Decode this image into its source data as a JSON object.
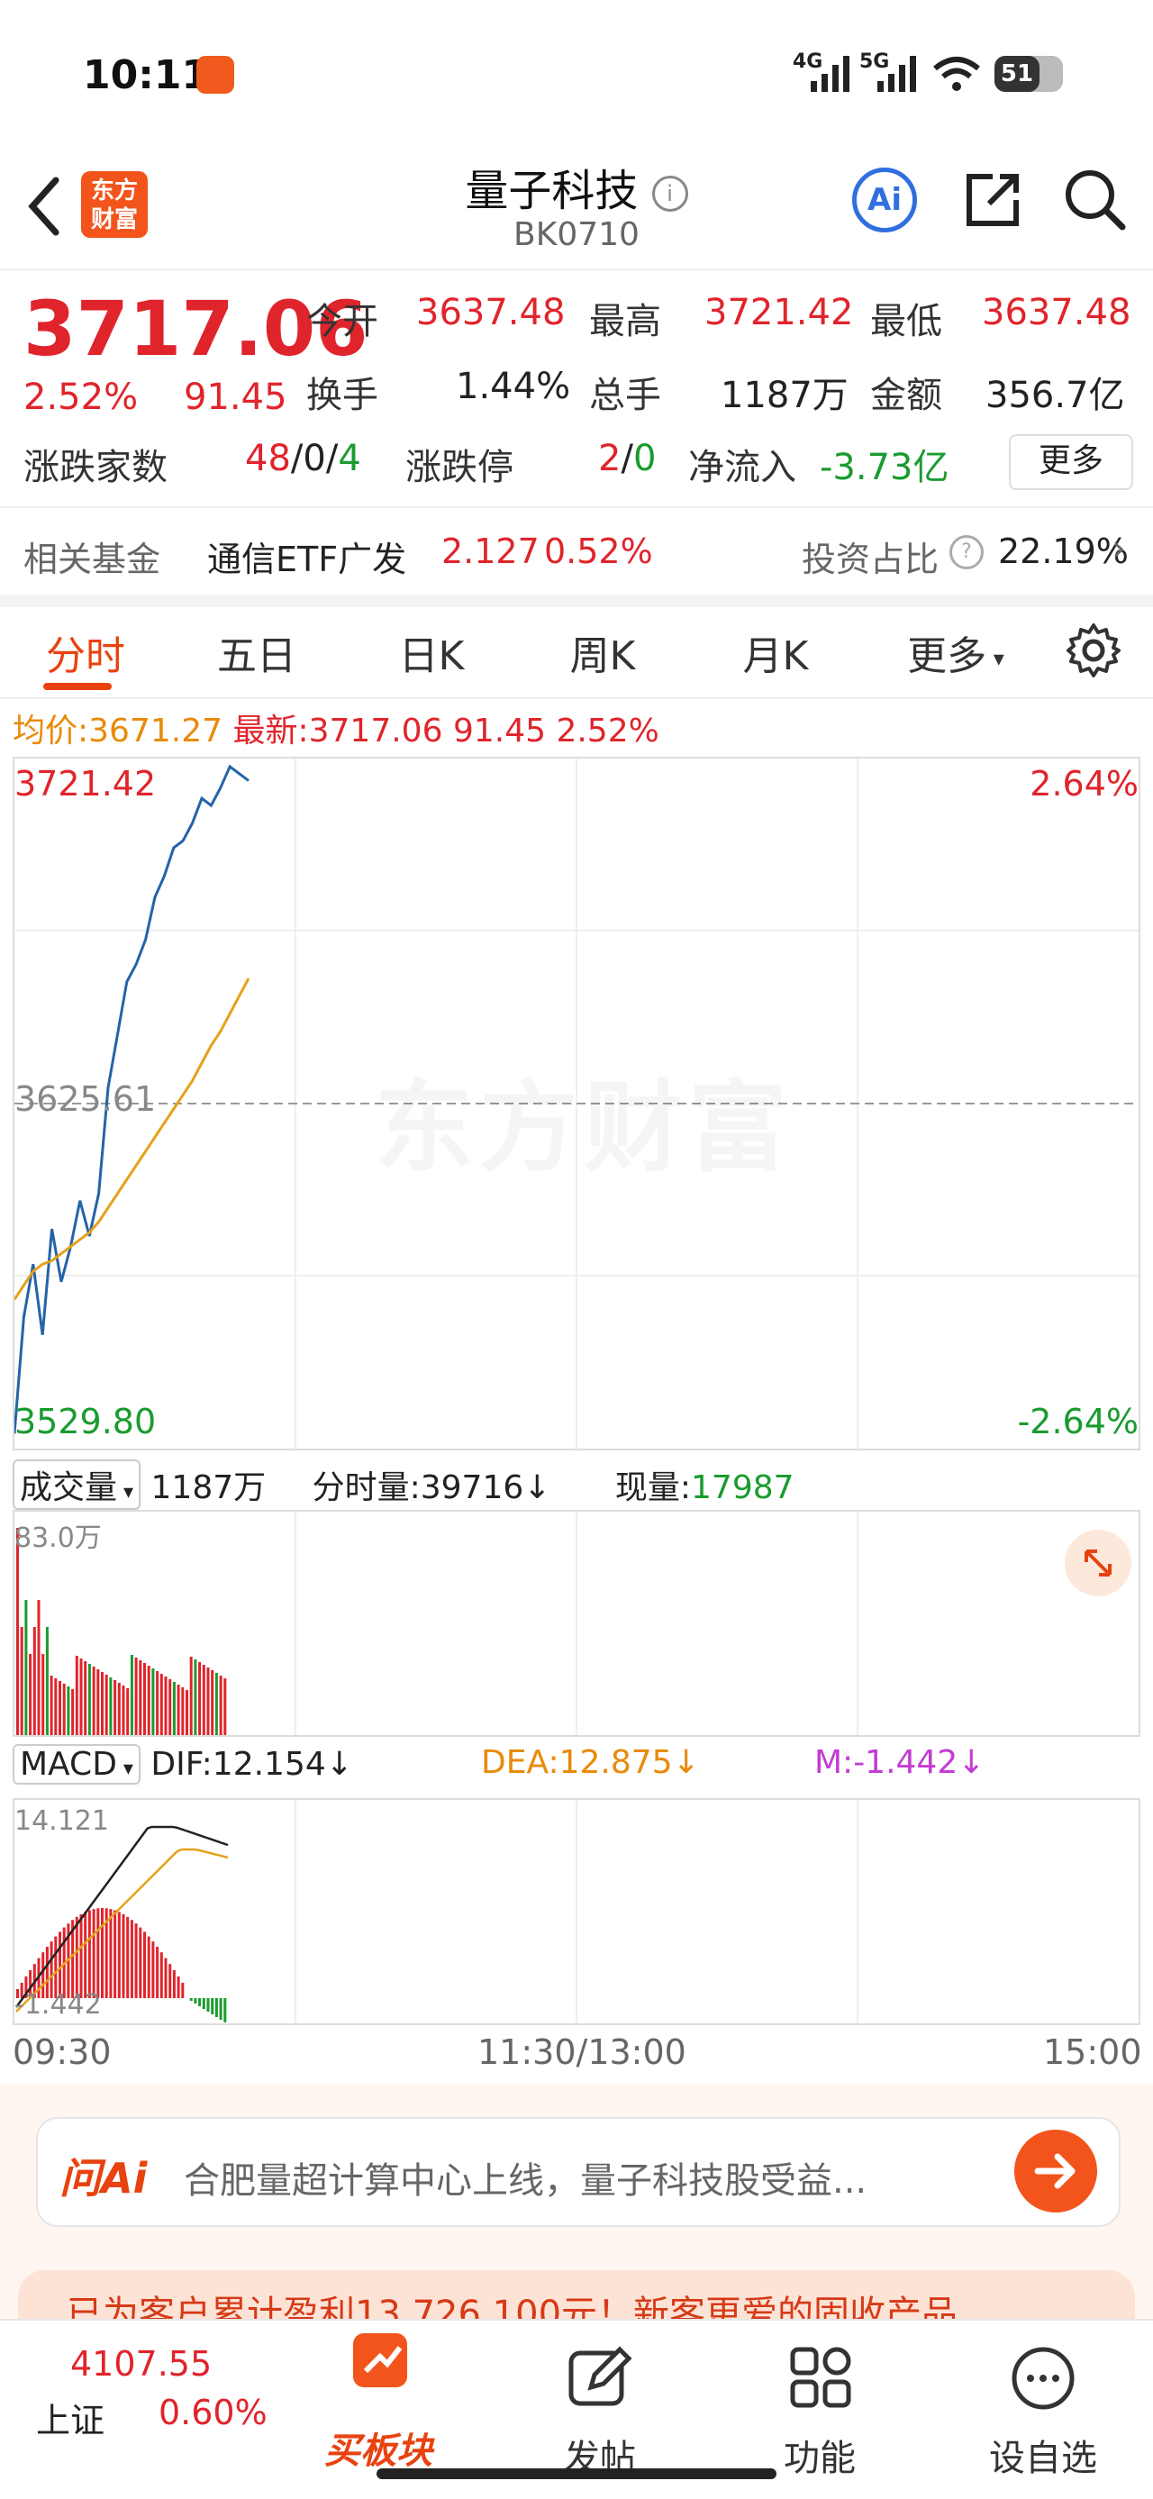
{
  "status": {
    "time": "10:11",
    "net1": "4G",
    "net2": "5G",
    "battery": "51"
  },
  "header": {
    "title": "量子科技",
    "code": "BK0710",
    "logo_line1": "东方",
    "logo_line2": "财富",
    "ai_label": "Ai"
  },
  "quote": {
    "price": "3717.06",
    "change_pct": "2.52%",
    "change": "91.45",
    "open_label": "今开",
    "open": "3637.48",
    "high_label": "最高",
    "high": "3721.42",
    "low_label": "最低",
    "low": "3637.48",
    "turnover_label": "换手",
    "turnover": "1.44%",
    "volume_label": "总手",
    "volume": "1187万",
    "amount_label": "金额",
    "amount": "356.7亿",
    "breadth_label": "涨跌家数",
    "breadth_up": "48",
    "breadth_sep1": "/",
    "breadth_flat": "0",
    "breadth_sep2": "/",
    "breadth_down": "4",
    "limit_label": "涨跌停",
    "limit_up": "2",
    "limit_sep": "/",
    "limit_down": "0",
    "netflow_label": "净流入",
    "netflow": "-3.73亿",
    "more_button": "更多"
  },
  "fund": {
    "label": "相关基金",
    "name": "通信ETF广发",
    "price": "2.127",
    "pct": "0.52%",
    "ratio_label": "投资占比",
    "ratio": "22.19%"
  },
  "tabs": [
    "分时",
    "五日",
    "日K",
    "周K",
    "月K",
    "更多"
  ],
  "intraday": {
    "avg_label": "均价:",
    "avg": "3671.27",
    "latest_label": "最新:",
    "latest": "3717.06",
    "latest_change": "91.45",
    "latest_pct": "2.52%",
    "y_top": "3721.42",
    "y_mid": "3625.61",
    "y_bottom": "3529.80",
    "pct_top": "2.64%",
    "pct_bottom": "-2.64%",
    "watermark": "东方财富"
  },
  "volume": {
    "label": "成交量",
    "total": "1187万",
    "minute_label": "分时量:",
    "minute": "39716",
    "minute_arrow": "↓",
    "current_label": "现量:",
    "current": "17987",
    "max_label": "83.0万"
  },
  "macd": {
    "label": "MACD",
    "dif": "DIF:12.154",
    "dea": "DEA:12.875",
    "m": "M:-1.442",
    "arrow": "↓",
    "top": "14.121",
    "bottom": "-1.442"
  },
  "time_axis": {
    "start": "09:30",
    "mid": "11:30/13:00",
    "end": "15:00"
  },
  "ai_bar": {
    "logo": "问Ai",
    "text": "合肥量超计算中心上线，量子科技股受益..."
  },
  "banner": {
    "text": "已为客户累计盈利13,726,100元！新客更爱的固收产品"
  },
  "bottom_nav": {
    "index_value": "4107.55",
    "index_name": "上证",
    "index_pct": "0.60%",
    "buy_label": "买板块",
    "post_label": "发帖",
    "func_label": "功能",
    "watch_label": "设自选"
  },
  "chart_data": {
    "type": "line",
    "x": [
      0,
      2,
      4,
      6,
      8,
      10,
      12,
      14,
      16,
      18,
      20,
      22,
      24,
      26,
      28,
      30,
      32,
      34,
      36,
      38,
      40,
      42,
      44,
      46,
      48,
      50
    ],
    "series": [
      {
        "name": "最新",
        "values": [
          3532,
          3565,
          3580,
          3560,
          3590,
          3575,
          3585,
          3598,
          3588,
          3600,
          3630,
          3645,
          3660,
          3665,
          3672,
          3684,
          3690,
          3698,
          3700,
          3705,
          3712,
          3710,
          3715,
          3721,
          3719,
          3717
        ]
      },
      {
        "name": "均价",
        "values": [
          3570,
          3574,
          3578,
          3580,
          3581,
          3583,
          3585,
          3587,
          3589,
          3592,
          3596,
          3600,
          3604,
          3608,
          3612,
          3616,
          3620,
          3624,
          3628,
          3632,
          3637,
          3642,
          3646,
          3651,
          3656,
          3661
        ]
      }
    ],
    "ylim": [
      3529.8,
      3721.42
    ]
  }
}
